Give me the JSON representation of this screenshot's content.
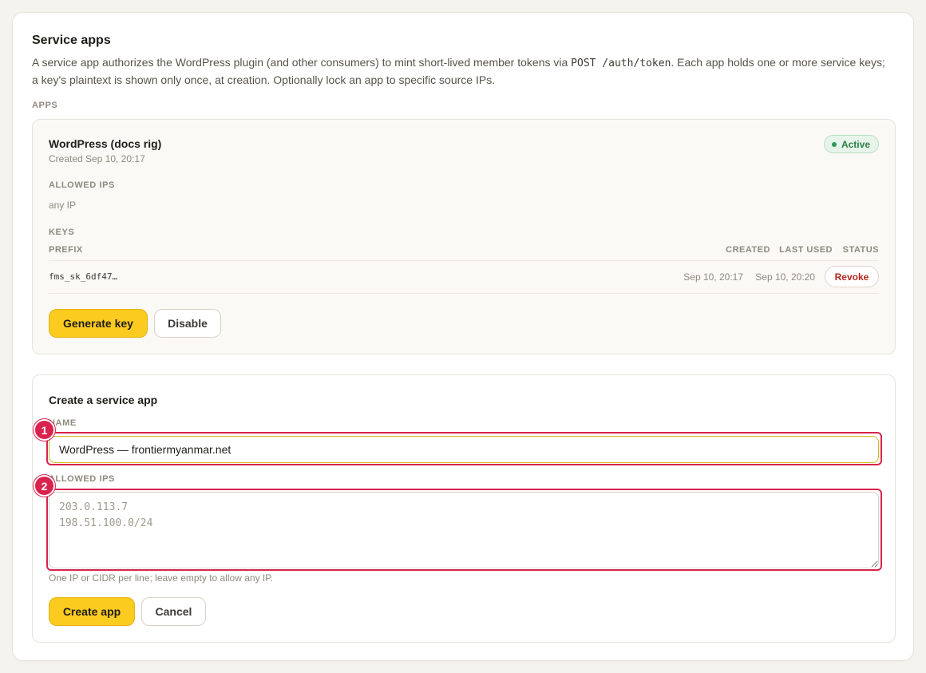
{
  "header": {
    "title": "Service apps",
    "desc_part1": "A service app authorizes the WordPress plugin (and other consumers) to mint short-lived member tokens via ",
    "desc_code": "POST /auth/token",
    "desc_part2": ". Each app holds one or more service keys; a key's plaintext is shown only once, at creation. Optionally lock an app to specific source IPs."
  },
  "apps_label": "APPS",
  "app": {
    "name": "WordPress (docs rig)",
    "created": "Created Sep 10, 20:17",
    "status": "Active",
    "allowed_ips_label": "ALLOWED IPS",
    "allowed_ips_value": "any IP",
    "keys_label": "KEYS",
    "columns": {
      "prefix": "PREFIX",
      "created": "CREATED",
      "last_used": "LAST USED",
      "status": "STATUS"
    },
    "keys": [
      {
        "prefix": "fms_sk_6df47…",
        "created": "Sep 10, 20:17",
        "last_used": "Sep 10, 20:20",
        "action": "Revoke"
      }
    ],
    "generate_label": "Generate key",
    "disable_label": "Disable"
  },
  "create_form": {
    "title": "Create a service app",
    "name_label": "NAME",
    "name_value": "WordPress — frontiermyanmar.net",
    "ips_label": "ALLOWED IPS",
    "ips_placeholder": "203.0.113.7\n198.51.100.0/24",
    "ips_hint": "One IP or CIDR per line; leave empty to allow any IP.",
    "create_label": "Create app",
    "cancel_label": "Cancel"
  },
  "markers": [
    "1",
    "2"
  ],
  "colors": {
    "accent": "#fccb1f",
    "highlight": "#d9234e",
    "active": "#2e7d46",
    "danger": "#b3261e"
  }
}
